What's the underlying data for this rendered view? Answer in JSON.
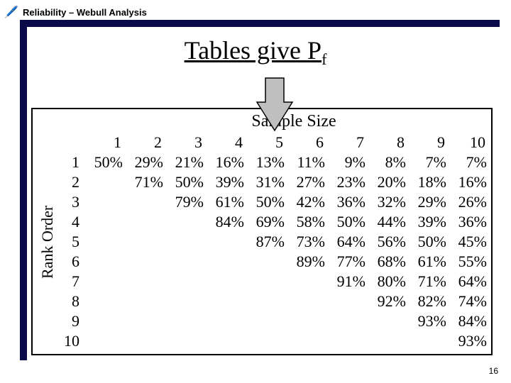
{
  "header": {
    "module": "Reliability – Webull Analysis"
  },
  "heading": {
    "pre": "Tables give P",
    "sub": "f"
  },
  "table": {
    "col_label": "Sample Size",
    "row_label": "Rank Order",
    "n": 10,
    "cols": [
      1,
      2,
      3,
      4,
      5,
      6,
      7,
      8,
      9,
      10
    ],
    "rows": [
      1,
      2,
      3,
      4,
      5,
      6,
      7,
      8,
      9,
      10
    ],
    "data": [
      [
        "50%",
        "29%",
        "21%",
        "16%",
        "13%",
        "11%",
        "9%",
        "8%",
        "7%",
        "7%"
      ],
      [
        "",
        "71%",
        "50%",
        "39%",
        "31%",
        "27%",
        "23%",
        "20%",
        "18%",
        "16%"
      ],
      [
        "",
        "",
        "79%",
        "61%",
        "50%",
        "42%",
        "36%",
        "32%",
        "29%",
        "26%"
      ],
      [
        "",
        "",
        "",
        "84%",
        "69%",
        "58%",
        "50%",
        "44%",
        "39%",
        "36%"
      ],
      [
        "",
        "",
        "",
        "",
        "87%",
        "73%",
        "64%",
        "56%",
        "50%",
        "45%"
      ],
      [
        "",
        "",
        "",
        "",
        "",
        "89%",
        "77%",
        "68%",
        "61%",
        "55%"
      ],
      [
        "",
        "",
        "",
        "",
        "",
        "",
        "91%",
        "80%",
        "71%",
        "64%"
      ],
      [
        "",
        "",
        "",
        "",
        "",
        "",
        "",
        "92%",
        "82%",
        "74%"
      ],
      [
        "",
        "",
        "",
        "",
        "",
        "",
        "",
        "",
        "93%",
        "84%"
      ],
      [
        "",
        "",
        "",
        "",
        "",
        "",
        "",
        "",
        "",
        "93%"
      ]
    ]
  },
  "pagenum": "16"
}
